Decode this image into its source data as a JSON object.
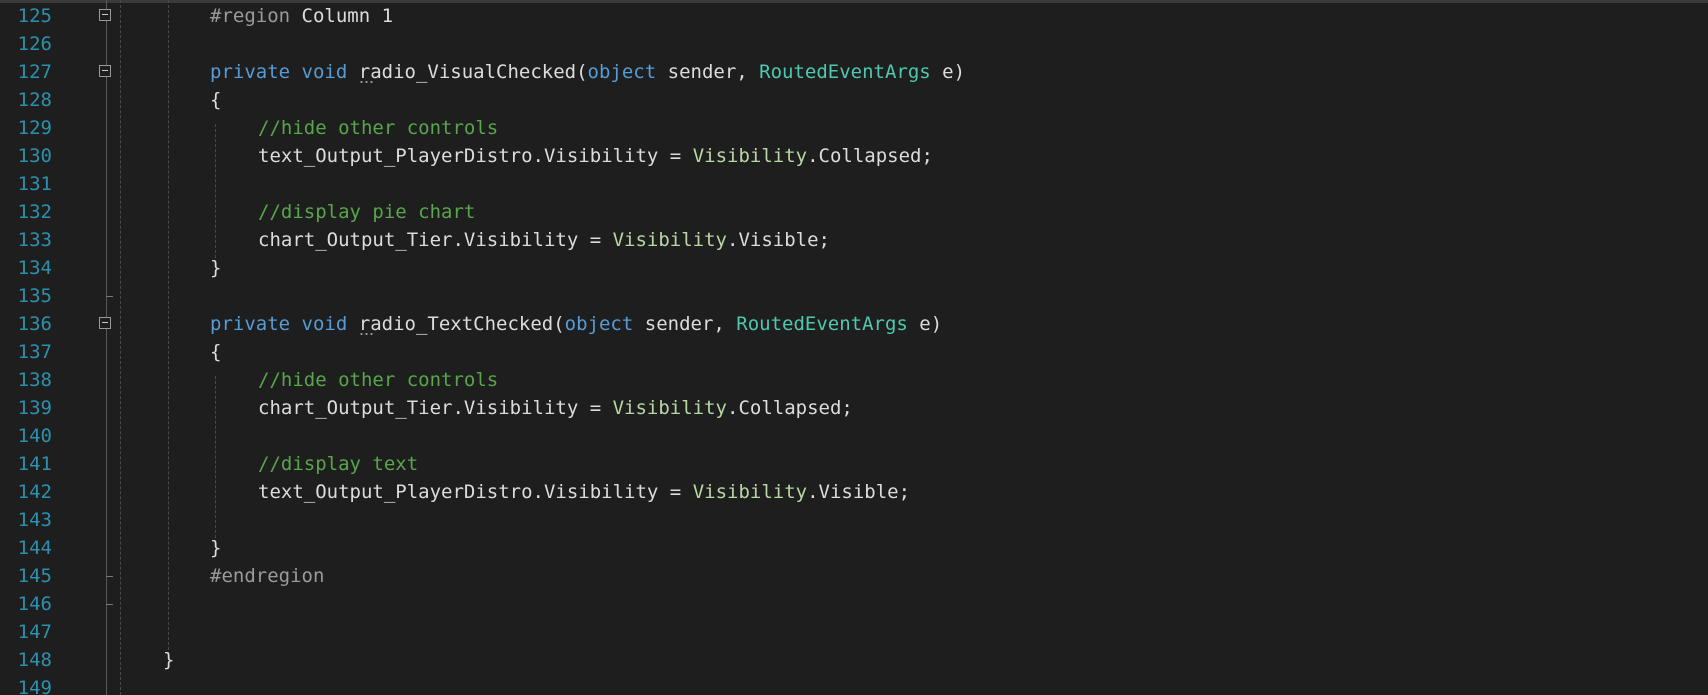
{
  "editor": {
    "lines": [
      {
        "n": "125",
        "fold": "start",
        "tokens": [
          {
            "t": "#region",
            "c": "pp"
          },
          {
            "t": " Column 1",
            "c": "tx"
          }
        ]
      },
      {
        "n": "126",
        "tokens": []
      },
      {
        "n": "127",
        "fold": "start",
        "tokens": [
          {
            "t": "private",
            "c": "kw"
          },
          {
            "t": " ",
            "c": "tx"
          },
          {
            "t": "void",
            "c": "kw"
          },
          {
            "t": " ",
            "c": "tx"
          },
          {
            "t": "radio_VisualChecked",
            "c": "mth"
          },
          {
            "t": "(",
            "c": "tx"
          },
          {
            "t": "object",
            "c": "kw"
          },
          {
            "t": " sender, ",
            "c": "tx"
          },
          {
            "t": "RoutedEventArgs",
            "c": "ty"
          },
          {
            "t": " e)",
            "c": "tx"
          }
        ]
      },
      {
        "n": "128",
        "tokens": [
          {
            "t": "{",
            "c": "tx"
          }
        ]
      },
      {
        "n": "129",
        "indent": 3,
        "tokens": [
          {
            "t": "//hide other controls",
            "c": "cm"
          }
        ]
      },
      {
        "n": "130",
        "indent": 3,
        "tokens": [
          {
            "t": "text_Output_PlayerDistro.Visibility = ",
            "c": "tx"
          },
          {
            "t": "Visibility",
            "c": "en"
          },
          {
            "t": ".Collapsed;",
            "c": "tx"
          }
        ]
      },
      {
        "n": "131",
        "tokens": []
      },
      {
        "n": "132",
        "indent": 3,
        "tokens": [
          {
            "t": "//display pie chart",
            "c": "cm"
          }
        ]
      },
      {
        "n": "133",
        "indent": 3,
        "tokens": [
          {
            "t": "chart_Output_Tier.Visibility = ",
            "c": "tx"
          },
          {
            "t": "Visibility",
            "c": "en"
          },
          {
            "t": ".Visible;",
            "c": "tx"
          }
        ]
      },
      {
        "n": "134",
        "tokens": [
          {
            "t": "}",
            "c": "tx"
          }
        ]
      },
      {
        "n": "135",
        "fold": "end",
        "tokens": []
      },
      {
        "n": "136",
        "fold": "start",
        "tokens": [
          {
            "t": "private",
            "c": "kw"
          },
          {
            "t": " ",
            "c": "tx"
          },
          {
            "t": "void",
            "c": "kw"
          },
          {
            "t": " ",
            "c": "tx"
          },
          {
            "t": "radio_TextChecked",
            "c": "mth"
          },
          {
            "t": "(",
            "c": "tx"
          },
          {
            "t": "object",
            "c": "kw"
          },
          {
            "t": " sender, ",
            "c": "tx"
          },
          {
            "t": "RoutedEventArgs",
            "c": "ty"
          },
          {
            "t": " e)",
            "c": "tx"
          }
        ]
      },
      {
        "n": "137",
        "tokens": [
          {
            "t": "{",
            "c": "tx"
          }
        ]
      },
      {
        "n": "138",
        "indent": 3,
        "tokens": [
          {
            "t": "//hide other controls",
            "c": "cm"
          }
        ]
      },
      {
        "n": "139",
        "indent": 3,
        "tokens": [
          {
            "t": "chart_Output_Tier.Visibility = ",
            "c": "tx"
          },
          {
            "t": "Visibility",
            "c": "en"
          },
          {
            "t": ".Collapsed;",
            "c": "tx"
          }
        ]
      },
      {
        "n": "140",
        "tokens": []
      },
      {
        "n": "141",
        "indent": 3,
        "tokens": [
          {
            "t": "//display text",
            "c": "cm"
          }
        ]
      },
      {
        "n": "142",
        "indent": 3,
        "tokens": [
          {
            "t": "text_Output_PlayerDistro.Visibility = ",
            "c": "tx"
          },
          {
            "t": "Visibility",
            "c": "en"
          },
          {
            "t": ".Visible;",
            "c": "tx"
          }
        ]
      },
      {
        "n": "143",
        "tokens": []
      },
      {
        "n": "144",
        "tokens": [
          {
            "t": "}",
            "c": "tx"
          }
        ]
      },
      {
        "n": "145",
        "fold": "end",
        "tokens": [
          {
            "t": "#endregion",
            "c": "pp"
          }
        ]
      },
      {
        "n": "146",
        "fold": "end",
        "tokens": []
      },
      {
        "n": "147",
        "tokens": []
      },
      {
        "n": "148",
        "indent": 1,
        "tokens": [
          {
            "t": "}",
            "c": "tx"
          }
        ]
      },
      {
        "n": "149",
        "tokens": []
      }
    ]
  },
  "colors": {
    "background": "#1e1e1e",
    "line_number": "#2b91af",
    "keyword": "#569cd6",
    "type": "#4ec9b0",
    "enum": "#b8d7a3",
    "comment": "#57a64a",
    "preprocessor": "#9b9b9b",
    "text": "#dcdcdc"
  }
}
